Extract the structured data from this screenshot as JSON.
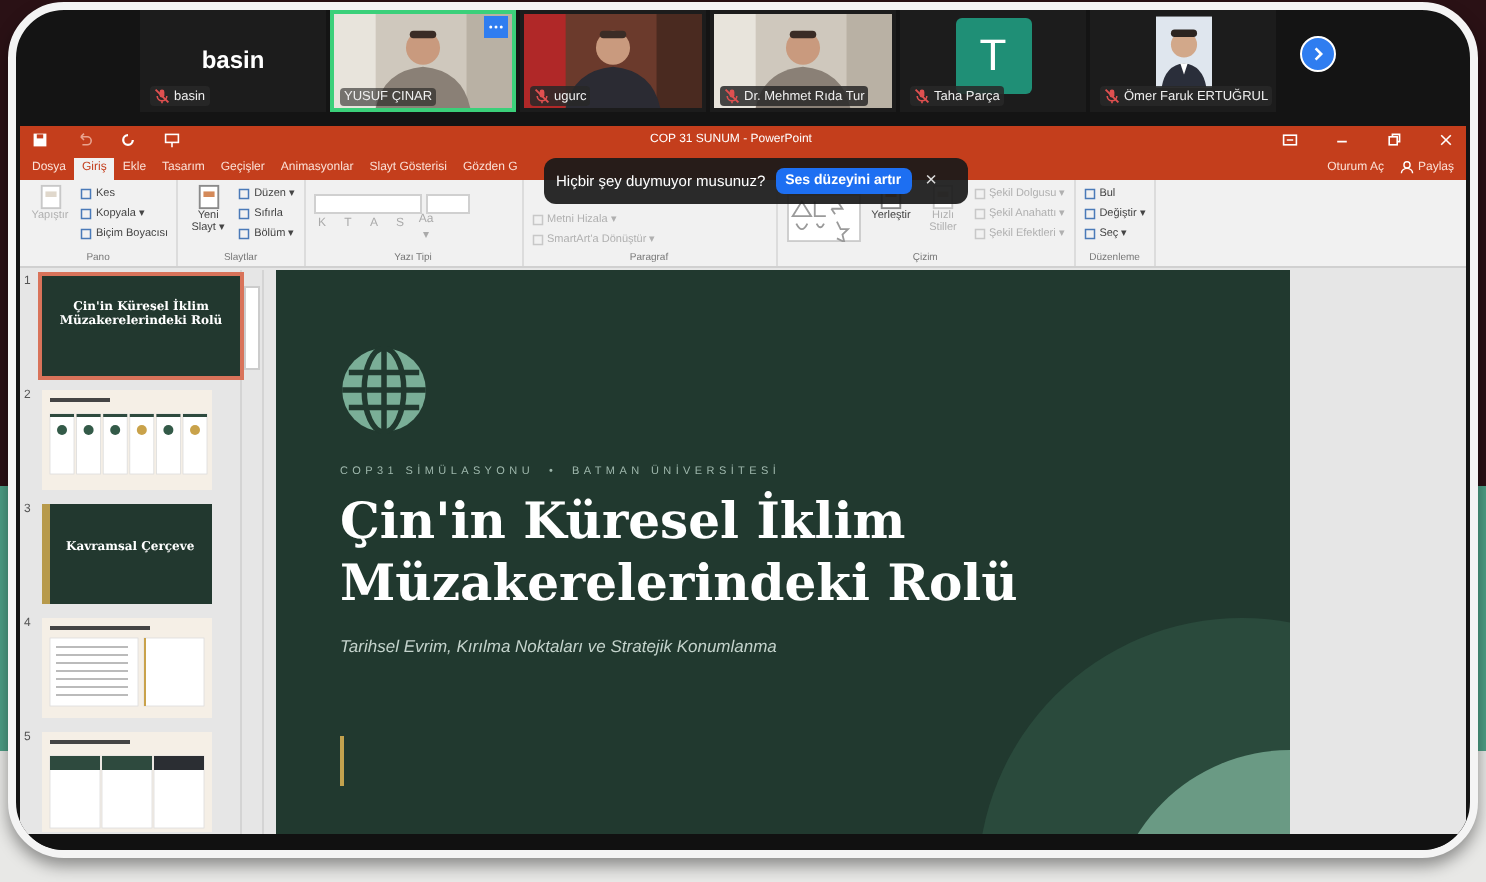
{
  "call": {
    "participants": [
      {
        "kind": "name_only",
        "name": "basin",
        "display_name": "basin",
        "muted": true,
        "speaking": false
      },
      {
        "kind": "video",
        "name": "YUSUF ÇINAR",
        "muted": false,
        "speaking": true
      },
      {
        "kind": "video",
        "name": "ugurc",
        "muted": true,
        "speaking": false
      },
      {
        "kind": "video",
        "name": "Dr. Mehmet Rıda Tur",
        "muted": true,
        "speaking": false
      },
      {
        "kind": "avatar",
        "name": "Taha Parça",
        "avatar_letter": "T",
        "muted": true,
        "speaking": false
      },
      {
        "name": "Ömer Faruk ERTUĞRUL",
        "muted": true,
        "speaking": false
      }
    ]
  },
  "powerpoint": {
    "title": "COP 31 SUNUM - PowerPoint",
    "tabs": [
      {
        "label": "Dosya",
        "selected": false
      },
      {
        "label": "Giriş",
        "selected": true
      },
      {
        "label": "Ekle",
        "selected": false
      },
      {
        "label": "Tasarım",
        "selected": false
      },
      {
        "label": "Geçişler",
        "selected": false
      },
      {
        "label": "Animasyonlar",
        "selected": false
      },
      {
        "label": "Slayt Gösterisi",
        "selected": false
      },
      {
        "label": "Gözden G",
        "selected": false
      }
    ],
    "sign_in": "Oturum Aç",
    "share": "Paylaş",
    "ribbon": [
      {
        "label": "Pano",
        "items": [
          {
            "kind": "large",
            "label": "Yapıştır",
            "disabled": true
          },
          {
            "kind": "small",
            "label": "Kes",
            "disabled": false
          },
          {
            "kind": "small",
            "label": "Kopyala ▾",
            "disabled": false
          },
          {
            "kind": "small",
            "label": "Biçim Boyacısı",
            "disabled": false
          }
        ]
      },
      {
        "label": "Slaytlar",
        "items": [
          {
            "kind": "large",
            "label": "Yeni Slayt ▾",
            "disabled": false
          },
          {
            "kind": "small",
            "label": "Düzen ▾",
            "disabled": false
          },
          {
            "kind": "small",
            "label": "Sıfırla",
            "disabled": false
          },
          {
            "kind": "small",
            "label": "Bölüm ▾",
            "disabled": false
          }
        ]
      },
      {
        "label": "Yazı Tipi",
        "items": [
          {
            "kind": "fontbox"
          },
          {
            "kind": "format",
            "label": "K",
            "disabled": true
          },
          {
            "kind": "format",
            "label": "T",
            "disabled": true
          },
          {
            "kind": "format",
            "label": "A",
            "disabled": true
          },
          {
            "kind": "format",
            "label": "S",
            "disabled": true
          },
          {
            "kind": "format",
            "label": "Aa ▾",
            "disabled": true
          }
        ]
      },
      {
        "label": "Paragraf",
        "items": [
          {
            "kind": "small",
            "label": "Metni Hizala ▾",
            "disabled": true
          },
          {
            "kind": "small",
            "label": "SmartArt'a Dönüştür ▾",
            "disabled": true
          }
        ]
      },
      {
        "label": "Çizim",
        "items": [
          {
            "kind": "shapes"
          },
          {
            "kind": "large",
            "label": "Yerleştir",
            "disabled": false
          },
          {
            "kind": "large",
            "label": "Hızlı Stiller",
            "disabled": true
          },
          {
            "kind": "small",
            "label": "Şekil Dolgusu ▾",
            "disabled": true
          },
          {
            "kind": "small",
            "label": "Şekil Anahattı ▾",
            "disabled": true
          },
          {
            "kind": "small",
            "label": "Şekil Efektleri ▾",
            "disabled": true
          }
        ]
      },
      {
        "label": "Düzenleme",
        "items": [
          {
            "kind": "small",
            "label": "Bul",
            "disabled": false
          },
          {
            "kind": "small",
            "label": "Değiştir ▾",
            "disabled": false
          },
          {
            "kind": "small",
            "label": "Seç ▾",
            "disabled": false
          }
        ]
      }
    ],
    "thumbnails": [
      {
        "number": "1",
        "selected": true,
        "kind": "title",
        "title": "Çin'in Küresel İklim Müzakerelerindeki Rolü"
      },
      {
        "number": "2",
        "selected": false,
        "kind": "cards"
      },
      {
        "number": "3",
        "selected": false,
        "kind": "section",
        "title": "Kavramsal Çerçeve"
      },
      {
        "number": "4",
        "selected": false,
        "kind": "text"
      },
      {
        "number": "5",
        "selected": false,
        "kind": "columns"
      }
    ],
    "slide": {
      "kicker": "COP31 SİMÜLASYONU  •  BATMAN ÜNİVERSİTESİ",
      "title_lines": [
        "Çin'in Küresel İklim",
        "Müzakerelerindeki Rolü"
      ],
      "subtitle": "Tarihsel Evrim, Kırılma Noktaları ve Stratejik Konumlanma"
    }
  },
  "toast": {
    "message": "Hiçbir şey duymuyor musunuz?",
    "button": "Ses düzeyini artır",
    "close": "×"
  }
}
